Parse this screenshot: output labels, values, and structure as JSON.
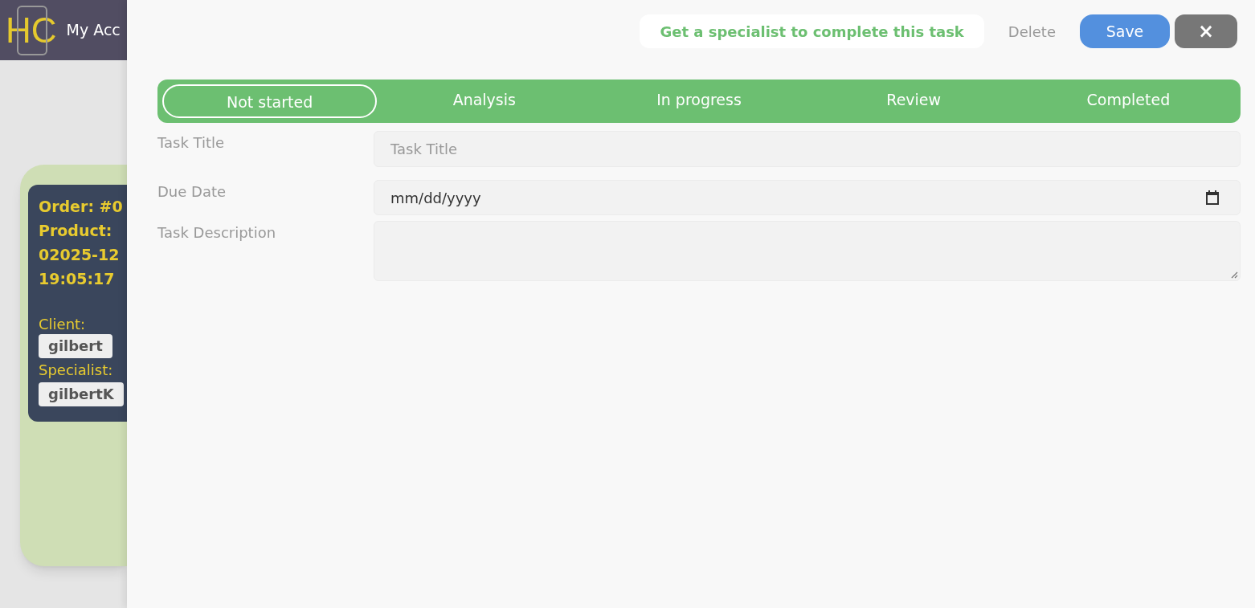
{
  "background": {
    "logo": "HC",
    "nav_link": "My Acc",
    "order_card": {
      "lines": [
        "Order: #0",
        "Product:",
        "02025-12",
        "19:05:17"
      ],
      "client_label": "Client:",
      "client": "gilbert",
      "specialist_label": "Specialist:",
      "specialist": "gilbertK"
    }
  },
  "panel": {
    "actions": {
      "get_specialist": "Get a specialist to complete this task",
      "delete": "Delete",
      "save": "Save",
      "close": "×"
    },
    "status_steps": [
      {
        "label": "Not started",
        "selected": true
      },
      {
        "label": "Analysis",
        "selected": false
      },
      {
        "label": "In progress",
        "selected": false
      },
      {
        "label": "Review",
        "selected": false
      },
      {
        "label": "Completed",
        "selected": false
      }
    ],
    "fields": [
      {
        "kind": "text",
        "label": "Task Title",
        "placeholder": "Task Title"
      },
      {
        "kind": "date",
        "label": "Due Date",
        "value": "mm/dd/yyyy"
      },
      {
        "kind": "textarea",
        "label": "Task Description"
      }
    ]
  }
}
